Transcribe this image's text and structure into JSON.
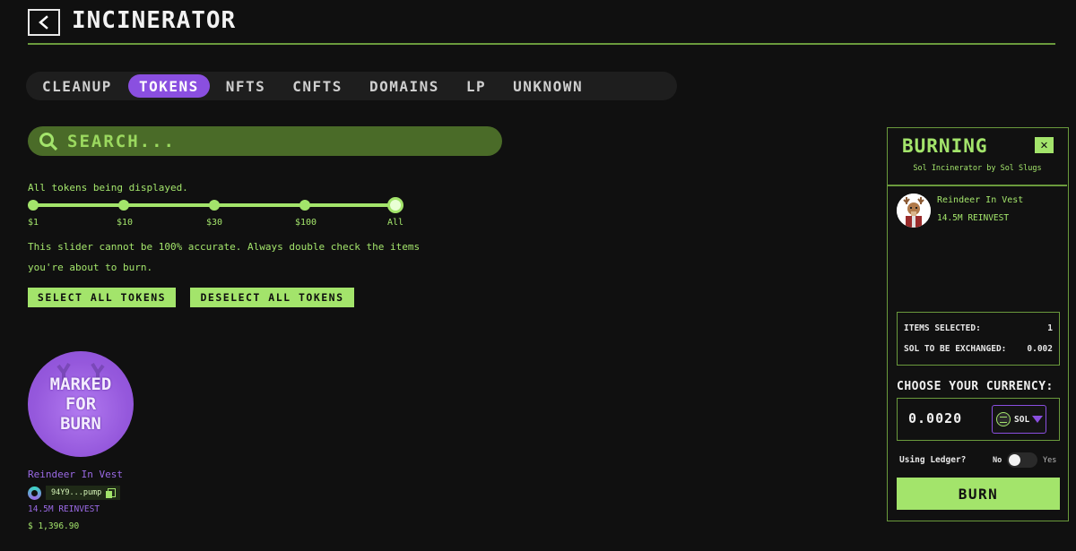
{
  "header": {
    "title": "INCINERATOR"
  },
  "tabs": [
    {
      "label": "CLEANUP",
      "active": false
    },
    {
      "label": "TOKENS",
      "active": true
    },
    {
      "label": "NFTS",
      "active": false
    },
    {
      "label": "CNFTS",
      "active": false
    },
    {
      "label": "DOMAINS",
      "active": false
    },
    {
      "label": "LP",
      "active": false
    },
    {
      "label": "UNKNOWN",
      "active": false
    }
  ],
  "search": {
    "placeholder": "SEARCH..."
  },
  "filter": {
    "status_text": "All tokens being displayed.",
    "slider_labels": [
      "$1",
      "$10",
      "$30",
      "$100",
      "All"
    ],
    "selected": "All",
    "warning": "This slider cannot be 100% accurate. Always double check the items you're about to burn."
  },
  "actions": {
    "select_all": "SELECT ALL TOKENS",
    "deselect_all": "DESELECT ALL TOKENS"
  },
  "token": {
    "overlay": "MARKED FOR BURN",
    "overlay_lines": [
      "MARKED",
      "FOR",
      "BURN"
    ],
    "name": "Reindeer In Vest",
    "address": "94Y9...pump",
    "amount": "14.5M REINVEST",
    "value": "$ 1,396.90"
  },
  "panel": {
    "title": "BURNING",
    "close_symbol": "✕",
    "subtitle": "Sol Incinerator by Sol Slugs",
    "item": {
      "name": "Reindeer In Vest",
      "amount": "14.5M REINVEST"
    },
    "items_selected_label": "ITEMS SELECTED:",
    "items_selected_value": "1",
    "sol_exchange_label": "SOL TO BE EXCHANGED:",
    "sol_exchange_value": "0.002",
    "currency_label": "CHOOSE YOUR CURRENCY:",
    "amount_value": "0.0020",
    "currency": "SOL",
    "ledger_label": "Using Ledger?",
    "ledger_no": "No",
    "ledger_yes": "Yes",
    "ledger_enabled": false,
    "burn_label": "BURN"
  },
  "colors": {
    "accent_green": "#a3e46b",
    "accent_purple": "#8a4fe0",
    "background": "#101010"
  }
}
